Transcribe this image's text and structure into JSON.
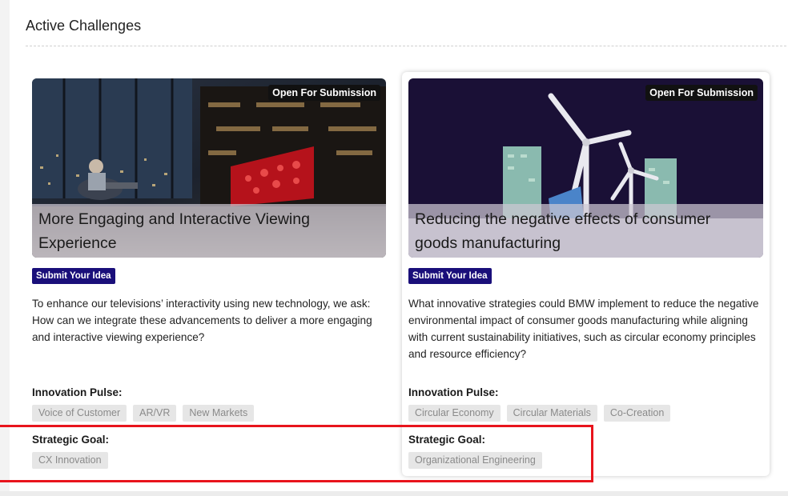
{
  "section": {
    "title": "Active Challenges"
  },
  "cards": [
    {
      "status": "Open For Submission",
      "title": "More Engaging and Interactive Viewing Experience",
      "submit_label": "Submit Your Idea",
      "description": "To enhance our televisions’ interactivity using new technology, we ask: How can we integrate these advancements to deliver a more engaging and interactive viewing experience?",
      "pulse_label": "Innovation Pulse:",
      "pulse_tags": [
        "Voice of Customer",
        "AR/VR",
        "New Markets"
      ],
      "goal_label": "Strategic Goal:",
      "goal_tags": [
        "CX Innovation"
      ]
    },
    {
      "status": "Open For Submission",
      "title": "Reducing the negative effects of consumer goods manufacturing",
      "submit_label": "Submit Your Idea",
      "description": "What innovative strategies could BMW implement to reduce the negative environmental impact of consumer goods manufacturing while aligning with current sustainability initiatives, such as circular economy principles and resource efficiency?",
      "pulse_label": "Innovation Pulse:",
      "pulse_tags": [
        "Circular Economy",
        "Circular Materials",
        "Co-Creation"
      ],
      "goal_label": "Strategic Goal:",
      "goal_tags": [
        "Organizational Engineering"
      ]
    }
  ],
  "colors": {
    "submit_button": "#1a0f7a",
    "badge": "#111111",
    "highlight": "#e8141c",
    "tag_bg": "#e6e6e6"
  }
}
